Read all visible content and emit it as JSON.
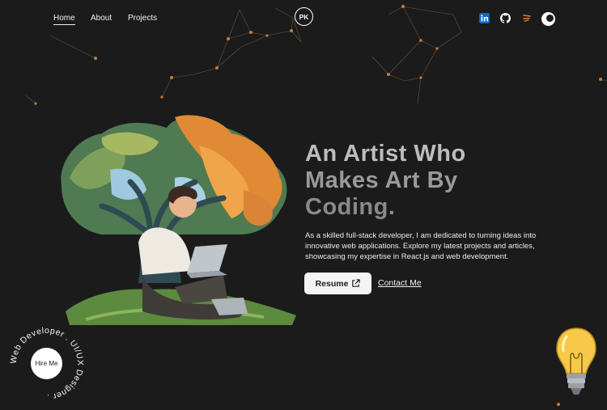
{
  "nav": {
    "home": "Home",
    "about": "About",
    "projects": "Projects",
    "logo": "PK"
  },
  "social": {
    "icons": [
      "linkedin-icon",
      "github-icon",
      "dribbble-icon",
      "theme-toggle-icon"
    ]
  },
  "hero": {
    "title_line1": "An Artist Who",
    "title_line2": "Makes Art By",
    "title_line3": "Coding.",
    "description": "As a skilled full-stack developer, I am dedicated to turning ideas into innovative web applications. Explore my latest projects and articles, showcasing my expertise in React.js and web development.",
    "resume_label": "Resume",
    "contact_label": "Contact Me"
  },
  "hire": {
    "label": "Hire Me",
    "ring_text": "Web Developer . UI/UX Designer . "
  },
  "colors": {
    "background": "#1b1b1b",
    "accent": "#c87a3a",
    "text": "#f5f5f5"
  }
}
